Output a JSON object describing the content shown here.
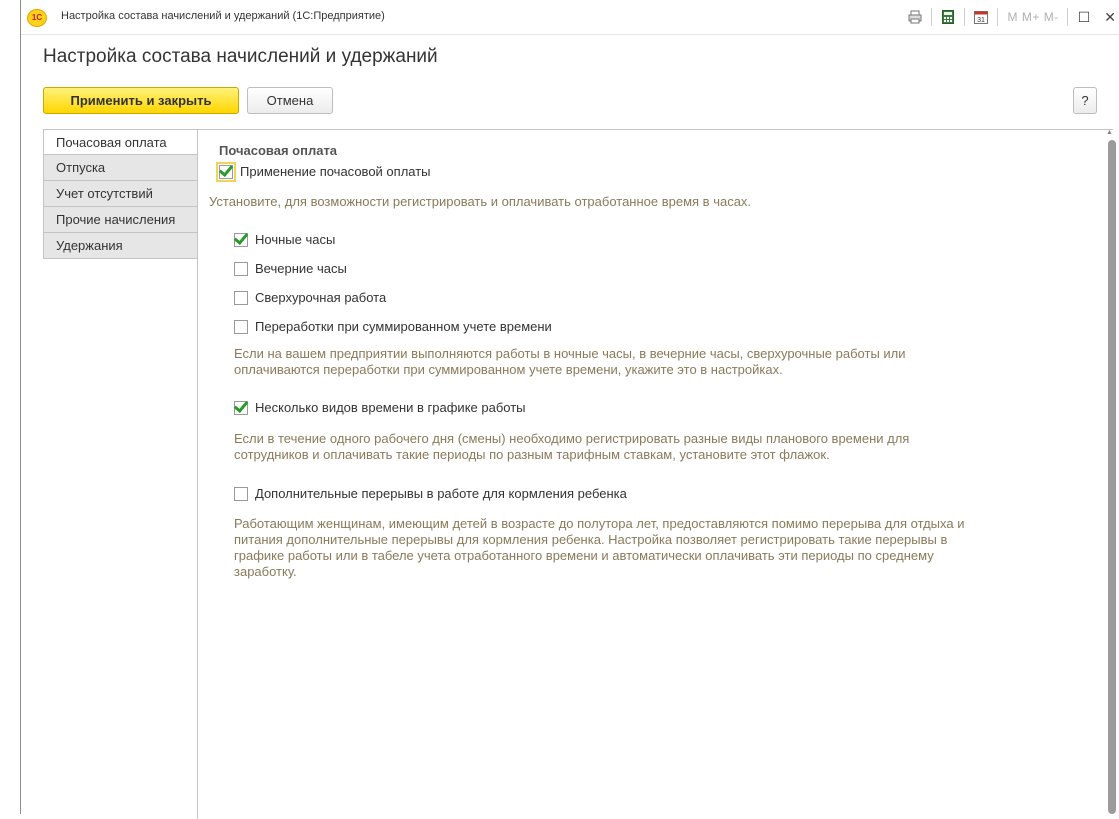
{
  "window": {
    "title": "Настройка состава начислений и удержаний  (1С:Предприятие)",
    "logo": "1С",
    "toolbar_icons": [
      "print-icon",
      "calculator-icon",
      "calendar-icon"
    ],
    "memory_buttons": "M  M+  M-",
    "calendar_day": "31"
  },
  "page": {
    "title": "Настройка состава начислений и удержаний"
  },
  "commands": {
    "apply_close": "Применить и закрыть",
    "cancel": "Отмена",
    "help": "?"
  },
  "tabs": [
    {
      "label": "Почасовая оплата",
      "active": true
    },
    {
      "label": "Отпуска",
      "active": false
    },
    {
      "label": "Учет отсутствий",
      "active": false
    },
    {
      "label": "Прочие начисления",
      "active": false
    },
    {
      "label": "Удержания",
      "active": false
    }
  ],
  "content": {
    "section_title": "Почасовая оплата",
    "main_check": {
      "label": "Применение почасовой оплаты",
      "checked": true
    },
    "main_hint": "Установите, для возможности регистрировать и оплачивать отработанное время в часах.",
    "options": [
      {
        "label": "Ночные часы",
        "checked": true
      },
      {
        "label": "Вечерние часы",
        "checked": false
      },
      {
        "label": "Сверхурочная работа",
        "checked": false
      },
      {
        "label": "Переработки при суммированном учете времени",
        "checked": false
      }
    ],
    "options_hint_1": "Если на вашем предприятии выполняются работы в ночные часы, в вечерние часы, сверхурочные работы или",
    "options_hint_2": "оплачиваются переработки при суммированном учете времени, укажите это в настройках.",
    "multi_time": {
      "label": "Несколько видов времени в графике работы",
      "checked": true
    },
    "multi_hint_1": "Если в течение одного рабочего дня (смены) необходимо регистрировать разные виды планового времени для",
    "multi_hint_2": "сотрудников и оплачивать такие периоды по разным тарифным ставкам, установите этот флажок.",
    "breaks": {
      "label": "Дополнительные перерывы в работе для кормления ребенка",
      "checked": false
    },
    "breaks_hint_1": "Работающим женщинам, имеющим детей в возрасте до полутора лет, предоставляются помимо перерыва для отдыха и",
    "breaks_hint_2": "питания дополнительные перерывы для кормления ребенка. Настройка позволяет регистрировать такие перерывы в",
    "breaks_hint_3": "графике работы или в табеле учета отработанного времени и автоматически оплачивать эти периоды по среднему",
    "breaks_hint_4": "заработку."
  },
  "colors": {
    "accent": "#ffd600",
    "check": "#2b9a2b",
    "hint": "#8a7a5a"
  }
}
